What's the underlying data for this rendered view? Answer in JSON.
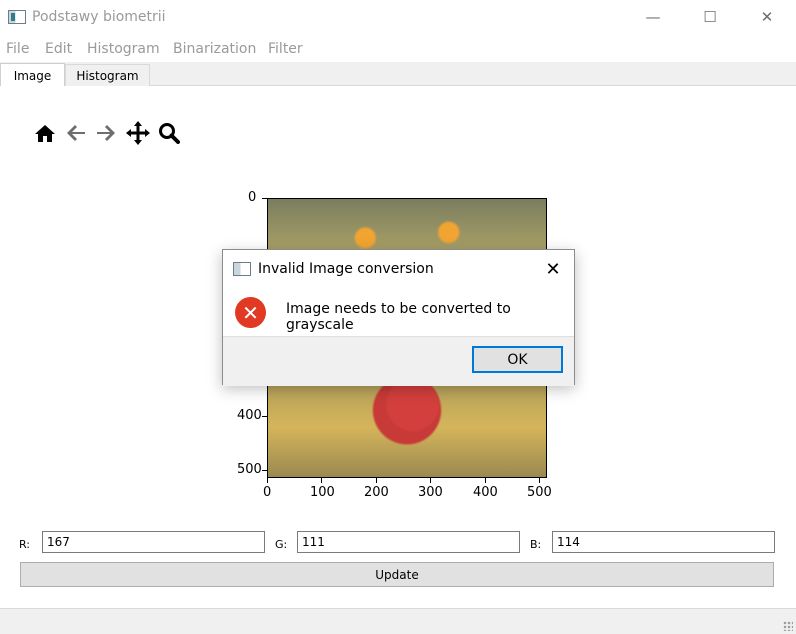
{
  "window": {
    "title": "Podstawy biometrii",
    "controls": {
      "minimize": "—",
      "maximize": "☐",
      "close": "✕"
    }
  },
  "menu": {
    "items": [
      "File",
      "Edit",
      "Histogram",
      "Binarization",
      "Filter"
    ]
  },
  "tabs": {
    "items": [
      {
        "label": "Image",
        "active": true
      },
      {
        "label": "Histogram",
        "active": false
      }
    ]
  },
  "toolbar": {
    "icons": [
      "home-icon",
      "back-arrow-icon",
      "forward-arrow-icon",
      "pan-move-icon",
      "zoom-icon"
    ]
  },
  "plot": {
    "xticks": [
      "0",
      "100",
      "200",
      "300",
      "400",
      "500"
    ],
    "yticks": [
      "0",
      "400",
      "500"
    ]
  },
  "rgb": {
    "r_label": "R:",
    "r_value": "167",
    "g_label": "G:",
    "g_value": "111",
    "b_label": "B:",
    "b_value": "114"
  },
  "update_label": "Update",
  "dialog": {
    "title": "Invalid Image conversion",
    "message": "Image needs to be converted to grayscale",
    "ok_label": "OK",
    "error_color": "#e03a25"
  }
}
